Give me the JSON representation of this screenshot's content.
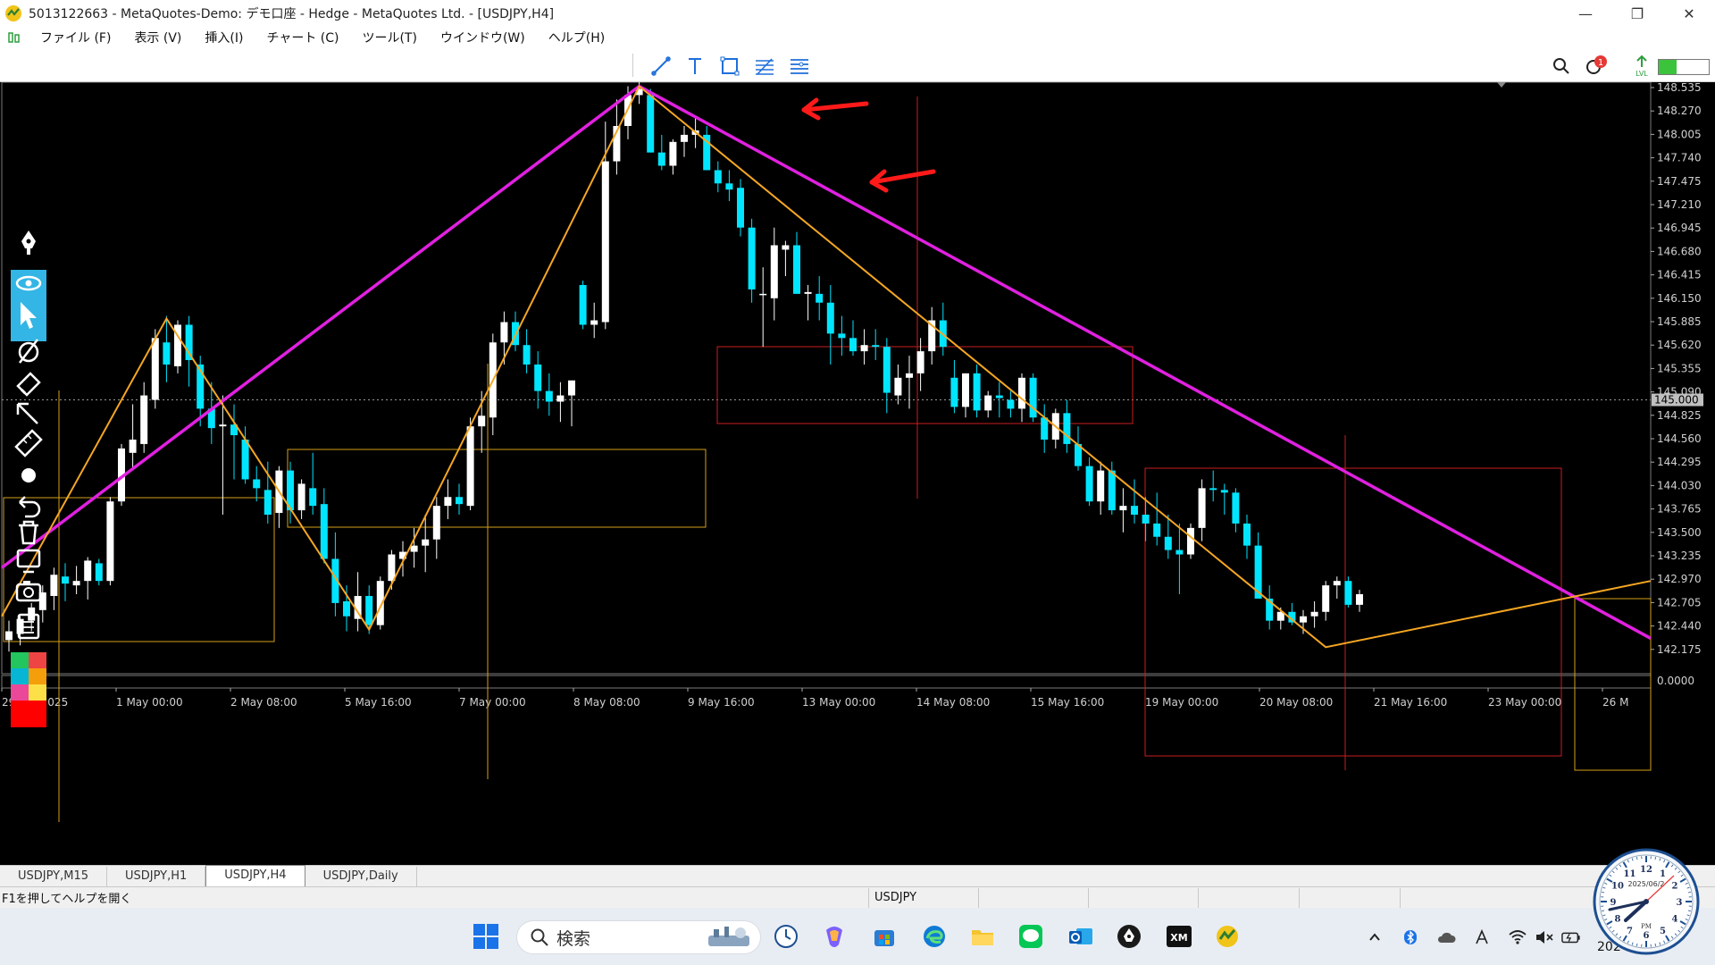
{
  "window": {
    "title": "5013122663 - MetaQuotes-Demo: デモ口座 - Hedge - MetaQuotes Ltd. - [USDJPY,H4]",
    "controls": [
      "—",
      "❐",
      "✕"
    ]
  },
  "menu": {
    "items": [
      "ファイル (F)",
      "表示 (V)",
      "挿入(I)",
      "チャート (C)",
      "ツール(T)",
      "ウインドウ(W)",
      "ヘルプ(H)"
    ],
    "mdi_controls": [
      "—",
      "❐",
      "✕"
    ]
  },
  "toolbar": {
    "notification_count": "1",
    "lvl_label": "LVL"
  },
  "chart": {
    "symbol": "USDJPY",
    "timeframe": "H4",
    "current_price_label": "145.000",
    "price_axis": [
      "148.535",
      "148.270",
      "148.005",
      "147.740",
      "147.475",
      "147.210",
      "146.945",
      "146.680",
      "146.415",
      "146.150",
      "145.885",
      "145.620",
      "145.355",
      "145.090",
      "144.825",
      "144.560",
      "144.295",
      "144.030",
      "143.765",
      "143.500",
      "143.235",
      "142.970",
      "142.705",
      "142.440",
      "142.175"
    ],
    "indicator_axis": "0.0000",
    "time_axis": [
      "29 Apr 2025",
      "1 May 00:00",
      "2 May 08:00",
      "5 May 16:00",
      "7 May 00:00",
      "8 May 08:00",
      "9 May 16:00",
      "13 May 00:00",
      "14 May 08:00",
      "15 May 16:00",
      "19 May 00:00",
      "20 May 08:00",
      "21 May 16:00",
      "23 May 00:00",
      "26 M"
    ],
    "colors": {
      "background": "#000000",
      "bull": "#ffffff",
      "bear": "#00e5ff",
      "zigzag_big": "#e020e0",
      "zigzag_small": "#f5a623",
      "box_red": "#c81e1e",
      "box_gold": "#d4a017",
      "arrow": "#ff1a1a"
    }
  },
  "tabs": [
    {
      "label": "USDJPY,M15",
      "active": false
    },
    {
      "label": "USDJPY,H1",
      "active": false
    },
    {
      "label": "USDJPY,H4",
      "active": true
    },
    {
      "label": "USDJPY,Daily",
      "active": false
    }
  ],
  "status": {
    "help": "F1を押してヘルプを開く",
    "symbol": "USDJPY"
  },
  "taskbar": {
    "search_placeholder": "検索",
    "clock_year": "202",
    "clock_date": "2025/06/2",
    "clock_ampm": "PM"
  },
  "palette": {
    "colors": [
      "#22c55e",
      "#ef4444",
      "#06b6d4",
      "#f59e0b",
      "#ec4899",
      "#fde047",
      "#ff0000"
    ]
  }
}
